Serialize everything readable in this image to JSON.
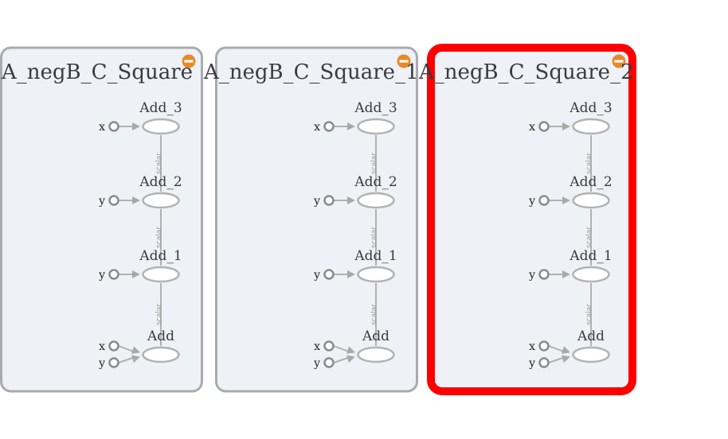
{
  "colors": {
    "panel_fill": "#eef1f6",
    "panel_border": "#a9abae",
    "selected_border": "#ff0000",
    "collapse_button": "#e8892a"
  },
  "icons": {
    "collapse": "minus-circle-icon"
  },
  "panels": [
    {
      "title": "A_negB_C_Square",
      "selected": false,
      "nodes": [
        {
          "label": "Add_3",
          "inputs": [
            "x"
          ],
          "edge_label": "scalar"
        },
        {
          "label": "Add_2",
          "inputs": [
            "y"
          ],
          "edge_label": "scalar"
        },
        {
          "label": "Add_1",
          "inputs": [
            "y"
          ],
          "edge_label": "scalar"
        },
        {
          "label": "Add",
          "inputs": [
            "x",
            "y"
          ]
        }
      ]
    },
    {
      "title": "A_negB_C_Square_1",
      "selected": false,
      "nodes": [
        {
          "label": "Add_3",
          "inputs": [
            "x"
          ],
          "edge_label": "scalar"
        },
        {
          "label": "Add_2",
          "inputs": [
            "y"
          ],
          "edge_label": "scalar"
        },
        {
          "label": "Add_1",
          "inputs": [
            "y"
          ],
          "edge_label": "scalar"
        },
        {
          "label": "Add",
          "inputs": [
            "x",
            "y"
          ]
        }
      ]
    },
    {
      "title": "A_negB_C_Square_2",
      "selected": true,
      "nodes": [
        {
          "label": "Add_3",
          "inputs": [
            "x"
          ],
          "edge_label": "scalar"
        },
        {
          "label": "Add_2",
          "inputs": [
            "y"
          ],
          "edge_label": "scalar"
        },
        {
          "label": "Add_1",
          "inputs": [
            "y"
          ],
          "edge_label": "scalar"
        },
        {
          "label": "Add",
          "inputs": [
            "x",
            "y"
          ]
        }
      ]
    }
  ]
}
